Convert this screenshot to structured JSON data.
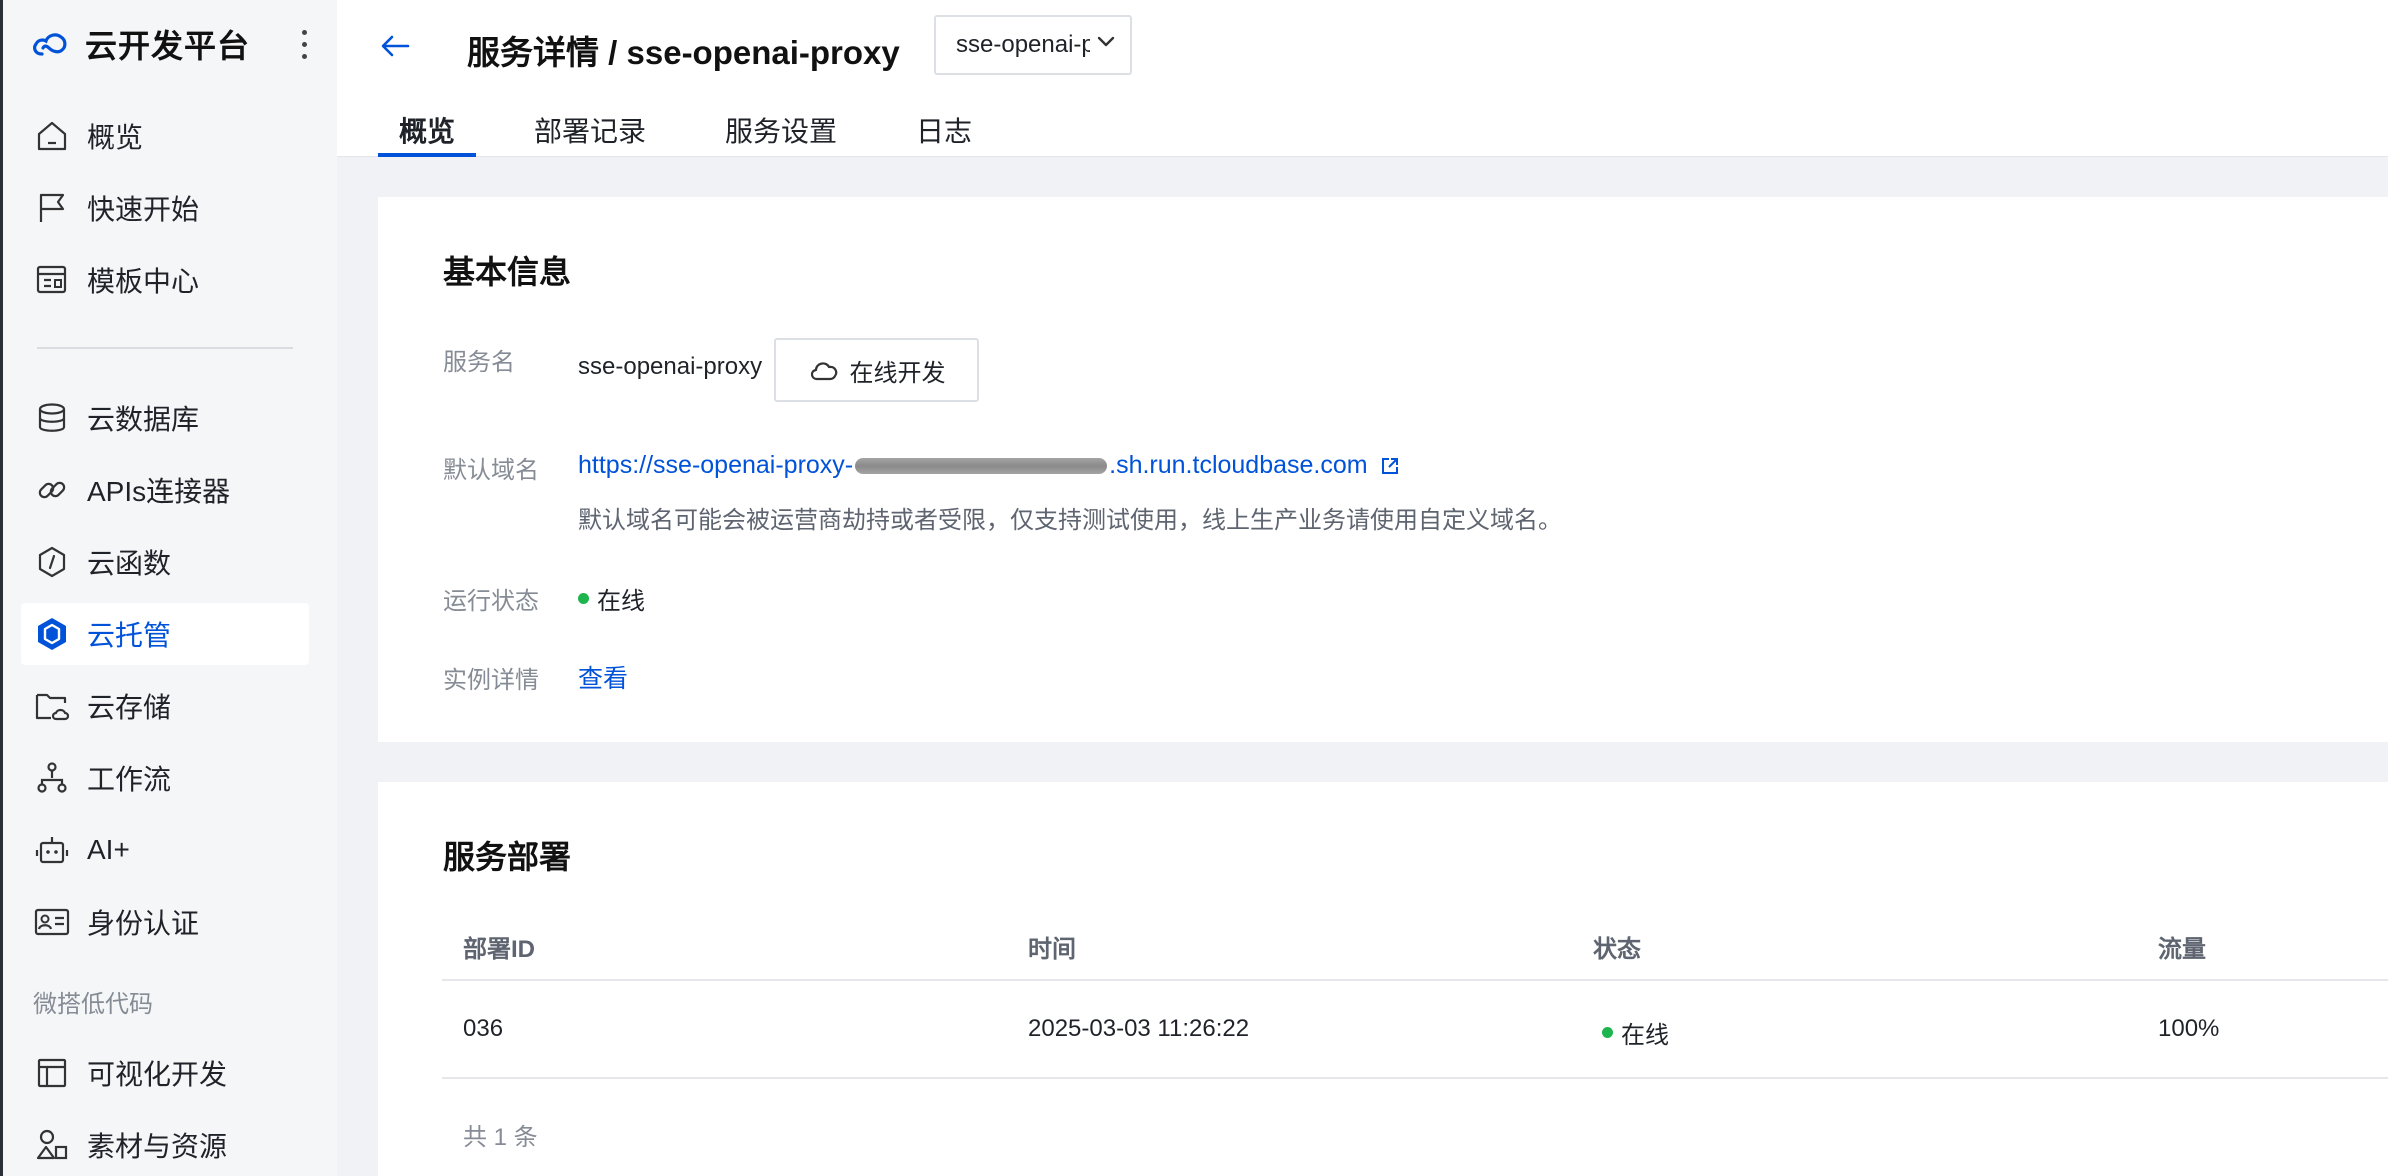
{
  "brand": {
    "title": "云开发平台"
  },
  "sidebar": {
    "items": [
      {
        "label": "概览",
        "icon": "home-icon"
      },
      {
        "label": "快速开始",
        "icon": "flag-icon"
      },
      {
        "label": "模板中心",
        "icon": "template-icon"
      },
      {
        "label": "云数据库",
        "icon": "database-icon"
      },
      {
        "label": "APIs连接器",
        "icon": "link-icon"
      },
      {
        "label": "云函数",
        "icon": "function-icon"
      },
      {
        "label": "云托管",
        "icon": "hexagon-icon",
        "active": true
      },
      {
        "label": "云存储",
        "icon": "folder-cloud-icon"
      },
      {
        "label": "工作流",
        "icon": "workflow-icon"
      },
      {
        "label": "AI+",
        "icon": "robot-icon"
      },
      {
        "label": "身份认证",
        "icon": "id-card-icon"
      }
    ],
    "group_label": "微搭低代码",
    "group_items": [
      {
        "label": "可视化开发",
        "icon": "layout-icon"
      },
      {
        "label": "素材与资源",
        "icon": "assets-icon"
      }
    ],
    "accent_color": "#0052d9"
  },
  "header": {
    "title": "服务详情 / sse-openai-proxy",
    "service_select": {
      "value": "sse-openai-proxy"
    },
    "tabs": [
      {
        "label": "概览",
        "active": true
      },
      {
        "label": "部署记录"
      },
      {
        "label": "服务设置"
      },
      {
        "label": "日志"
      }
    ]
  },
  "basic_info": {
    "title": "基本信息",
    "service_name_label": "服务名",
    "service_name": "sse-openai-proxy",
    "online_dev_button": "在线开发",
    "default_domain_label": "默认域名",
    "domain_prefix": "https://sse-openai-proxy-",
    "domain_suffix": ".sh.run.tcloudbase.com",
    "domain_hint": "默认域名可能会被运营商劫持或者受限，仅支持测试使用，线上生产业务请使用自定义域名。",
    "run_status_label": "运行状态",
    "run_status": "在线",
    "instance_label": "实例详情",
    "instance_link": "查看",
    "status_color": "#1fb54e"
  },
  "deployment": {
    "title": "服务部署",
    "columns": [
      "部署ID",
      "时间",
      "状态",
      "流量"
    ],
    "rows": [
      {
        "id": "036",
        "time": "2025-03-03 11:26:22",
        "status": "在线",
        "traffic": "100%"
      }
    ],
    "footer": "共 1 条"
  }
}
